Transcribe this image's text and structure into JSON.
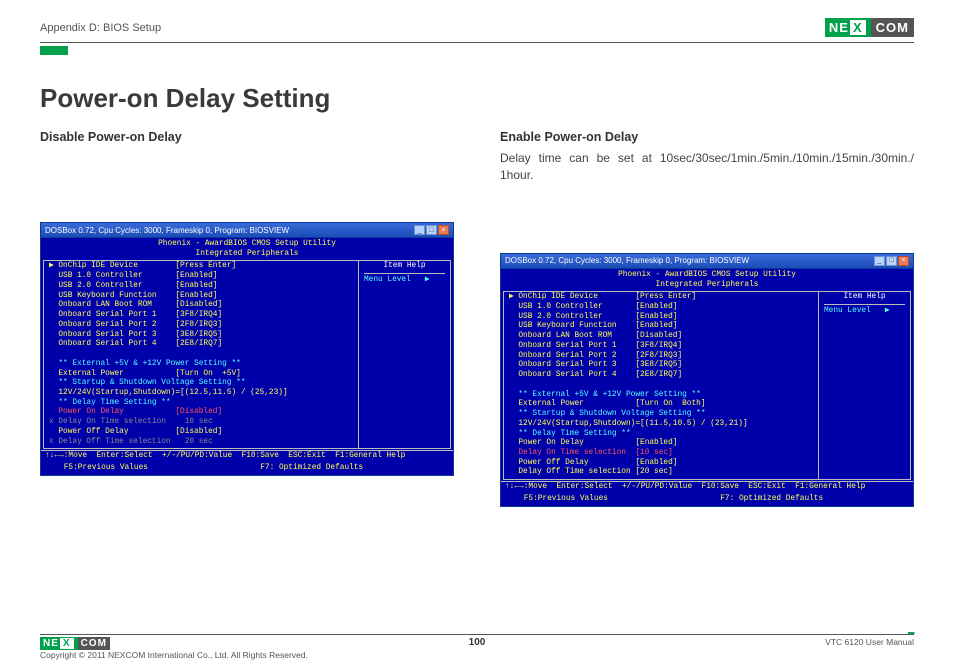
{
  "header": {
    "appendix": "Appendix D: BIOS Setup",
    "brand_left": "NE",
    "brand_x": "X",
    "brand_right": "COM"
  },
  "title": "Power-on Delay Setting",
  "left": {
    "heading": "Disable Power-on Delay"
  },
  "right": {
    "heading": "Enable Power-on Delay",
    "body": "Delay time can be set at 10sec/30sec/1min./5min./10min./15min./30min./ 1hour."
  },
  "win": {
    "title": "DOSBox 0.72, Cpu Cycles:   3000, Frameskip  0, Program: BIOSVIEW",
    "min": "_",
    "max": "□",
    "close": "×"
  },
  "bios_common": {
    "hdr1": "Phoenix - AwardBIOS CMOS Setup Utility",
    "hdr2": "Integrated Peripherals",
    "side_head": "Item Help",
    "side_menu": "Menu Level   ▶",
    "foot1": "↑↓←→:Move  Enter:Select  +/-/PU/PD:Value  F10:Save  ESC:Exit  F1:General Help",
    "foot2": "    F5:Previous Values                        F7: Optimized Defaults"
  },
  "bios_left": {
    "lines": [
      {
        "t": "▶ OnChip IDE Device        [Press Enter]",
        "c": "yellow"
      },
      {
        "t": "  USB 1.0 Controller       [Enabled]",
        "c": "yellow"
      },
      {
        "t": "  USB 2.0 Controller       [Enabled]",
        "c": "yellow"
      },
      {
        "t": "  USB Keyboard Function    [Enabled]",
        "c": "yellow"
      },
      {
        "t": "  Onboard LAN Boot ROM     [Disabled]",
        "c": "yellow"
      },
      {
        "t": "  Onboard Serial Port 1    [3F8/IRQ4]",
        "c": "yellow"
      },
      {
        "t": "  Onboard Serial Port 2    [2F8/IRQ3]",
        "c": "yellow"
      },
      {
        "t": "  Onboard Serial Port 3    [3E8/IRQ5]",
        "c": "yellow"
      },
      {
        "t": "  Onboard Serial Port 4    [2E8/IRQ7]",
        "c": "yellow"
      },
      {
        "t": " ",
        "c": ""
      },
      {
        "t": "  ** External +5V & +12V Power Setting **",
        "c": "cyan"
      },
      {
        "t": "  External Power           [Turn On  +5V]",
        "c": "yellow"
      },
      {
        "t": "  ** Startup & Shutdown Voltage Setting **",
        "c": "cyan"
      },
      {
        "t": "  12V/24V(Startup,Shutdown)=[(12.5,11.5) / (25,23)]",
        "c": "yellow"
      },
      {
        "t": "  ** Delay Time Setting **",
        "c": "cyan"
      },
      {
        "t": "  Power On Delay           [Disabled]",
        "c": "red"
      },
      {
        "t": "x Delay On Time selection    10 sec",
        "c": "gray"
      },
      {
        "t": "  Power Off Delay          [Disabled]",
        "c": "yellow"
      },
      {
        "t": "x Delay Off Time selection   20 sec",
        "c": "gray"
      }
    ]
  },
  "bios_right": {
    "lines": [
      {
        "t": "▶ OnChip IDE Device        [Press Enter]",
        "c": "yellow"
      },
      {
        "t": "  USB 1.0 Controller       [Enabled]",
        "c": "yellow"
      },
      {
        "t": "  USB 2.0 Controller       [Enabled]",
        "c": "yellow"
      },
      {
        "t": "  USB Keyboard Function    [Enabled]",
        "c": "yellow"
      },
      {
        "t": "  Onboard LAN Boot ROM     [Disabled]",
        "c": "yellow"
      },
      {
        "t": "  Onboard Serial Port 1    [3F8/IRQ4]",
        "c": "yellow"
      },
      {
        "t": "  Onboard Serial Port 2    [2F8/IRQ3]",
        "c": "yellow"
      },
      {
        "t": "  Onboard Serial Port 3    [3E8/IRQ5]",
        "c": "yellow"
      },
      {
        "t": "  Onboard Serial Port 4    [2E8/IRQ7]",
        "c": "yellow"
      },
      {
        "t": " ",
        "c": ""
      },
      {
        "t": "  ** External +5V & +12V Power Setting **",
        "c": "cyan"
      },
      {
        "t": "  External Power           [Turn On  Both]",
        "c": "yellow"
      },
      {
        "t": "  ** Startup & Shutdown Voltage Setting **",
        "c": "cyan"
      },
      {
        "t": "  12V/24V(Startup,Shutdown)=[(11.5,10.5) / (23,21)]",
        "c": "yellow"
      },
      {
        "t": "  ** Delay Time Setting **",
        "c": "cyan"
      },
      {
        "t": "  Power On Delay           [Enabled]",
        "c": "yellow"
      },
      {
        "t": "  Delay On Time selection  [10 sec]",
        "c": "red"
      },
      {
        "t": "  Power Off Delay          [Enabled]",
        "c": "yellow"
      },
      {
        "t": "  Delay Off Time selection [20 sec]",
        "c": "yellow"
      }
    ]
  },
  "footer": {
    "copyright": "Copyright © 2011 NEXCOM International Co., Ltd. All Rights Reserved.",
    "page": "100",
    "manual": "VTC 6120 User Manual"
  }
}
